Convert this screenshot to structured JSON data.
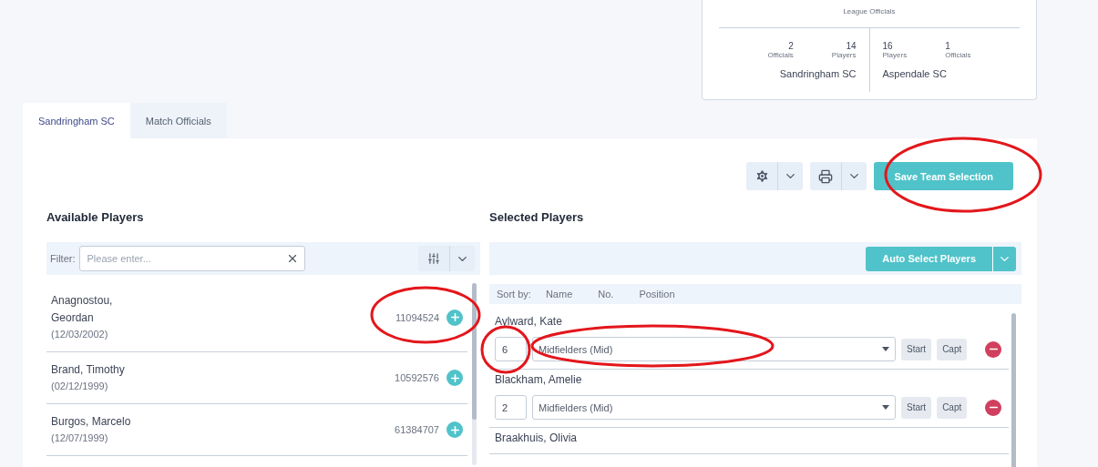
{
  "summary": {
    "caption": "League Officials",
    "teams": [
      {
        "name": "Sandringham SC",
        "stats": [
          {
            "value": "2",
            "label": "Officials"
          },
          {
            "value": "14",
            "label": "Players"
          }
        ]
      },
      {
        "name": "Aspendale SC",
        "stats": [
          {
            "value": "16",
            "label": "Players"
          },
          {
            "value": "1",
            "label": "Officials"
          }
        ]
      }
    ]
  },
  "tabs": [
    {
      "label": "Sandringham SC",
      "selected": true
    },
    {
      "label": "Match Officials",
      "selected": false
    }
  ],
  "toolbar": {
    "save_button": "Save Team Selection"
  },
  "available": {
    "title": "Available Players",
    "filter_label": "Filter:",
    "filter_placeholder": "Please enter...",
    "players": [
      {
        "name": "Anagnostou, Geordan",
        "dob": "(12/03/2002)",
        "id": "11094524"
      },
      {
        "name": "Brand, Timothy",
        "dob": "(02/12/1999)",
        "id": "10592576"
      },
      {
        "name": "Burgos, Marcelo",
        "dob": "(12/07/1999)",
        "id": "61384707"
      }
    ]
  },
  "selected": {
    "title": "Selected Players",
    "auto_button": "Auto Select Players",
    "sort_label": "Sort by:",
    "sort_options": [
      "Name",
      "No.",
      "Position"
    ],
    "players": [
      {
        "name": "Aylward, Kate",
        "number": "6",
        "position": "Midfielders (Mid)",
        "start": "Start",
        "captain": "Capt"
      },
      {
        "name": "Blackham, Amelie",
        "number": "2",
        "position": "Midfielders (Mid)",
        "start": "Start",
        "captain": "Capt"
      },
      {
        "name": "Braakhuis, Olivia"
      }
    ]
  }
}
